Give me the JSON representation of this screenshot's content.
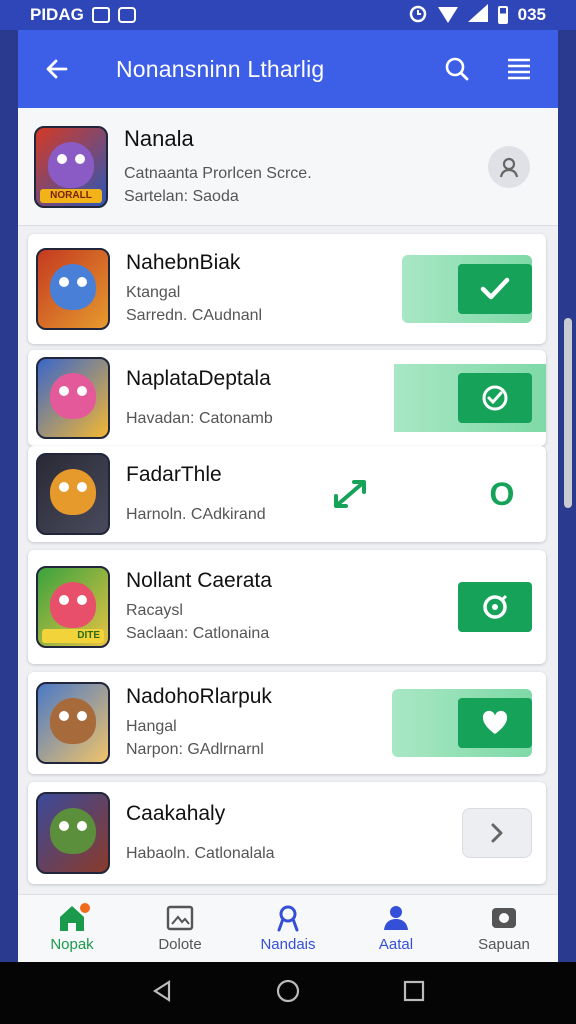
{
  "status": {
    "left": "PIDAG",
    "time": "035"
  },
  "app_bar": {
    "title": "Nonansninn Ltharlig"
  },
  "header": {
    "name": "Nanala",
    "line1": "Catnaanta Prorlcen Scrce.",
    "line2": "Sartelan: Saoda"
  },
  "items": [
    {
      "name": "NahebnBiak",
      "line1": "Ktangal",
      "line2": "Sarredn. CAudnanl",
      "action": "check",
      "colors": [
        "#b8321f",
        "#4a7fd8"
      ]
    },
    {
      "name": "NaplataDeptala",
      "line1": "",
      "line2": "Havadan: Catonamb",
      "action": "check-circle",
      "colors": [
        "#3a66c9",
        "#e4599a"
      ]
    },
    {
      "name": "FadarThle",
      "line1": "",
      "line2": "Harnoln. CAdkirand",
      "action": "o",
      "action_label": "O",
      "colors": [
        "#2a2a36",
        "#e79a2c"
      ]
    },
    {
      "name": "Nollant Caerata",
      "line1": "Racaysl",
      "line2": "Saclaan: Catlonaina",
      "action": "target",
      "colors": [
        "#3aa33f",
        "#e84f6a"
      ]
    },
    {
      "name": "NadohoRlarpuk",
      "line1": "Hangal",
      "line2": "Narpon: GAdlrnarnl",
      "action": "heart",
      "colors": [
        "#4b79c7",
        "#a76a3b"
      ]
    },
    {
      "name": "Caakahaly",
      "line1": "",
      "line2": "Habaoln. Catlonalala",
      "action": "chevron",
      "colors": [
        "#3b4a9a",
        "#5c8f3b"
      ]
    }
  ],
  "tag_labels": {
    "header_icon": "NORALL",
    "item4_icon": "DITE"
  },
  "nav": [
    {
      "label": "Nopak"
    },
    {
      "label": "Dolote"
    },
    {
      "label": "Nandais"
    },
    {
      "label": "Aatal"
    },
    {
      "label": "Sapuan"
    }
  ]
}
